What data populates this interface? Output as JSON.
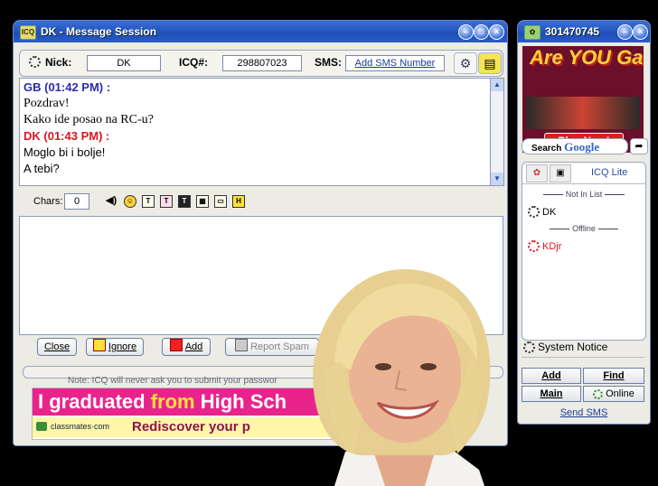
{
  "message_window": {
    "title": "DK - Message Session",
    "icon_label": "ICQ",
    "nick_label": "Nick:",
    "nick_value": "DK",
    "icq_label": "ICQ#:",
    "icq_value": "298807023",
    "sms_label": "SMS:",
    "sms_link": "Add SMS Number",
    "messages": [
      {
        "header": "GB (01:42 PM) :",
        "color": "#2b2bb0",
        "lines": [
          "Pozdrav!",
          "Kako ide posao na RC-u?"
        ]
      },
      {
        "header": "DK (01:43 PM) :",
        "color": "#e0141e",
        "lines": [
          "Moglo bi i bolje!",
          "A tebi?"
        ]
      }
    ],
    "chars_label": "Chars:",
    "chars_value": "0",
    "buttons": {
      "close": "Close",
      "ignore": "Ignore",
      "add": "Add",
      "report_spam": "Report Spam"
    },
    "note": "Note: ICQ will never ask you to submit your passwor",
    "ad": {
      "line1_white": "I graduated",
      "line1_yellow": "from",
      "line1_white2": "High Sch",
      "brand": "classmates·com",
      "tagline": "Rediscover your p"
    }
  },
  "contact_list": {
    "uin": "301470745",
    "ad_text": "Are YOU Game?",
    "ad_play": "Play Now!",
    "search_label": "Search",
    "search_brand": "Google",
    "tab_label": "ICQ Lite",
    "groups": {
      "not_in_list": "Not In List",
      "offline": "Offline"
    },
    "contacts": [
      {
        "name": "DK",
        "color": "#000000"
      },
      {
        "name": "KDjr",
        "color": "#e0141e"
      }
    ],
    "system_notice": "System Notice",
    "btn_add": "Add",
    "btn_find": "Find",
    "btn_main": "Main",
    "btn_online": "Online",
    "send_sms": "Send SMS"
  },
  "colors": {
    "titlebar": "#2a5cc8",
    "window": "#ecebe4",
    "ad_pink": "#e8248c"
  },
  "icons": [
    "flower-icon",
    "gear-icon",
    "file-icon",
    "scroll-up-icon",
    "scroll-down-icon",
    "sound-icon",
    "smiley-icon",
    "text-format-icon",
    "go-arrow-icon"
  ]
}
